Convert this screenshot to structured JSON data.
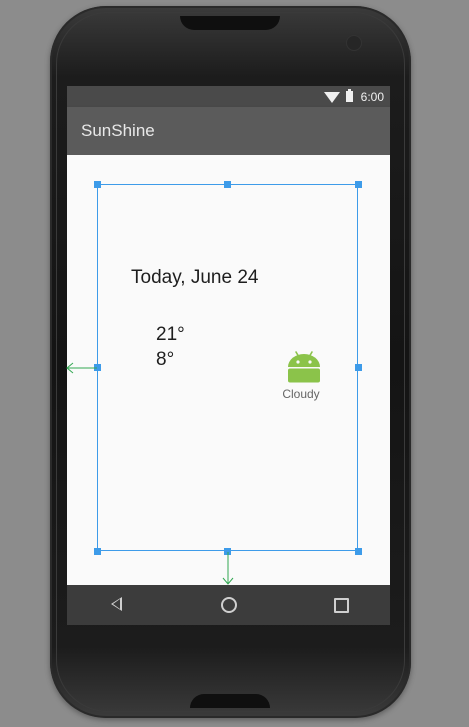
{
  "status_bar": {
    "time": "6:00",
    "icons": [
      "wifi-icon",
      "battery-icon"
    ]
  },
  "app_bar": {
    "title": "SunShine"
  },
  "forecast": {
    "date": "Today,  June 24",
    "high": "21°",
    "low": "8°",
    "description": "Cloudy",
    "icon": "android-robot-icon",
    "icon_color": "#8bc34a"
  },
  "nav_bar": {
    "buttons": [
      "back-icon",
      "home-icon",
      "recents-icon"
    ]
  },
  "editor": {
    "selection_color": "#3d9be9",
    "constraint_color": "#33a853"
  }
}
